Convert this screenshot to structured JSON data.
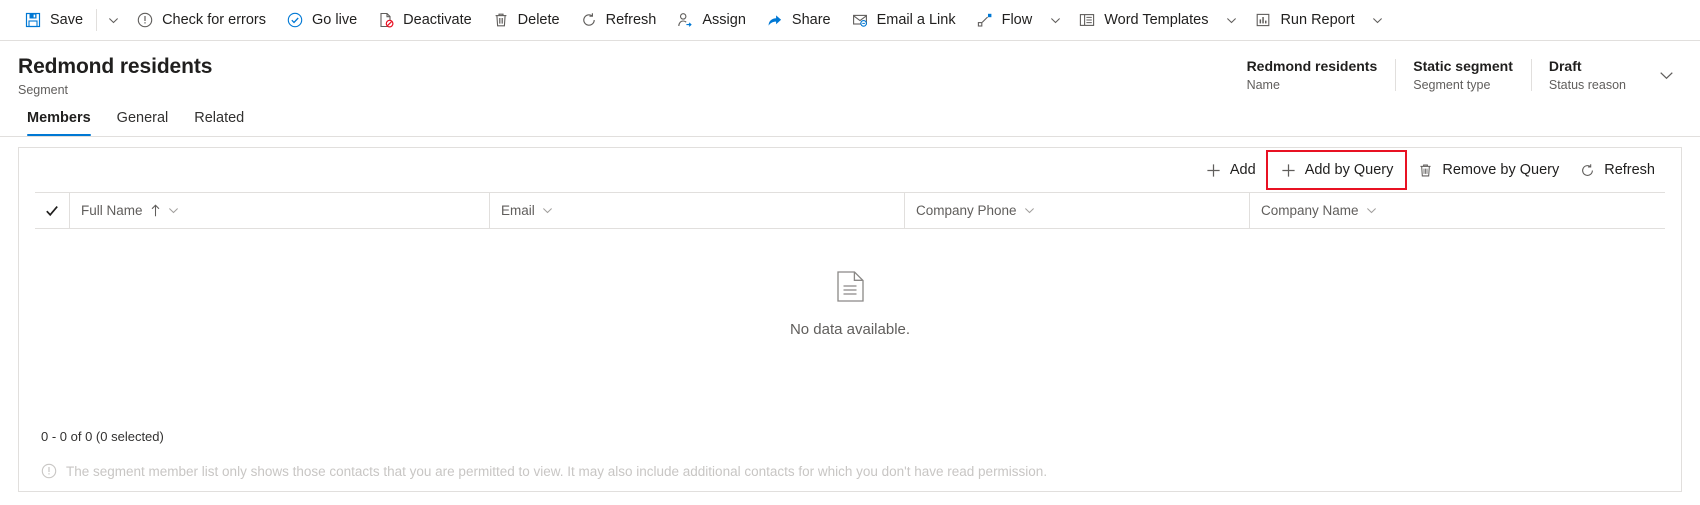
{
  "colors": {
    "accent": "#0078d4",
    "highlight": "#e81123",
    "text": "#201f1e",
    "subtext": "#605e5c",
    "border": "#e1dfdd",
    "muted": "#c8c6c4"
  },
  "command_bar": {
    "items": [
      {
        "label": "Save",
        "icon": "save-icon",
        "has_split": true
      },
      {
        "label": "Check for errors",
        "icon": "error-circle-icon",
        "has_split": false
      },
      {
        "label": "Go live",
        "icon": "check-circle-icon",
        "has_split": false
      },
      {
        "label": "Deactivate",
        "icon": "deactivate-icon",
        "has_split": false
      },
      {
        "label": "Delete",
        "icon": "trash-icon",
        "has_split": false
      },
      {
        "label": "Refresh",
        "icon": "refresh-icon",
        "has_split": false
      },
      {
        "label": "Assign",
        "icon": "assign-person-icon",
        "has_split": false
      },
      {
        "label": "Share",
        "icon": "share-icon",
        "has_split": false
      },
      {
        "label": "Email a Link",
        "icon": "email-link-icon",
        "has_split": false
      },
      {
        "label": "Flow",
        "icon": "flow-icon",
        "has_split": true
      },
      {
        "label": "Word Templates",
        "icon": "word-template-icon",
        "has_split": true
      },
      {
        "label": "Run Report",
        "icon": "run-report-icon",
        "has_split": true
      }
    ]
  },
  "header": {
    "title": "Redmond residents",
    "subtitle": "Segment",
    "fields": [
      {
        "value": "Redmond residents",
        "label": "Name"
      },
      {
        "value": "Static segment",
        "label": "Segment type"
      },
      {
        "value": "Draft",
        "label": "Status reason"
      }
    ]
  },
  "tabs": [
    {
      "label": "Members",
      "active": true
    },
    {
      "label": "General",
      "active": false
    },
    {
      "label": "Related",
      "active": false
    }
  ],
  "grid_commands": [
    {
      "label": "Add",
      "icon": "plus-icon",
      "highlighted": false
    },
    {
      "label": "Add by Query",
      "icon": "plus-icon",
      "highlighted": true
    },
    {
      "label": "Remove by Query",
      "icon": "trash-icon",
      "highlighted": false
    },
    {
      "label": "Refresh",
      "icon": "refresh-icon",
      "highlighted": false
    }
  ],
  "grid": {
    "select_all_icon": "checkmark-icon",
    "columns": [
      {
        "label": "Full Name",
        "sorted": "ascending"
      },
      {
        "label": "Email",
        "sorted": ""
      },
      {
        "label": "Company Phone",
        "sorted": ""
      },
      {
        "label": "Company Name",
        "sorted": ""
      }
    ],
    "empty_state": {
      "icon": "document-icon",
      "text": "No data available."
    },
    "record_count": "0 - 0 of 0 (0 selected)",
    "notice": {
      "icon": "info-icon",
      "text": "The segment member list only shows those contacts that you are permitted to view. It may also include additional contacts for which you don't have read permission."
    }
  }
}
